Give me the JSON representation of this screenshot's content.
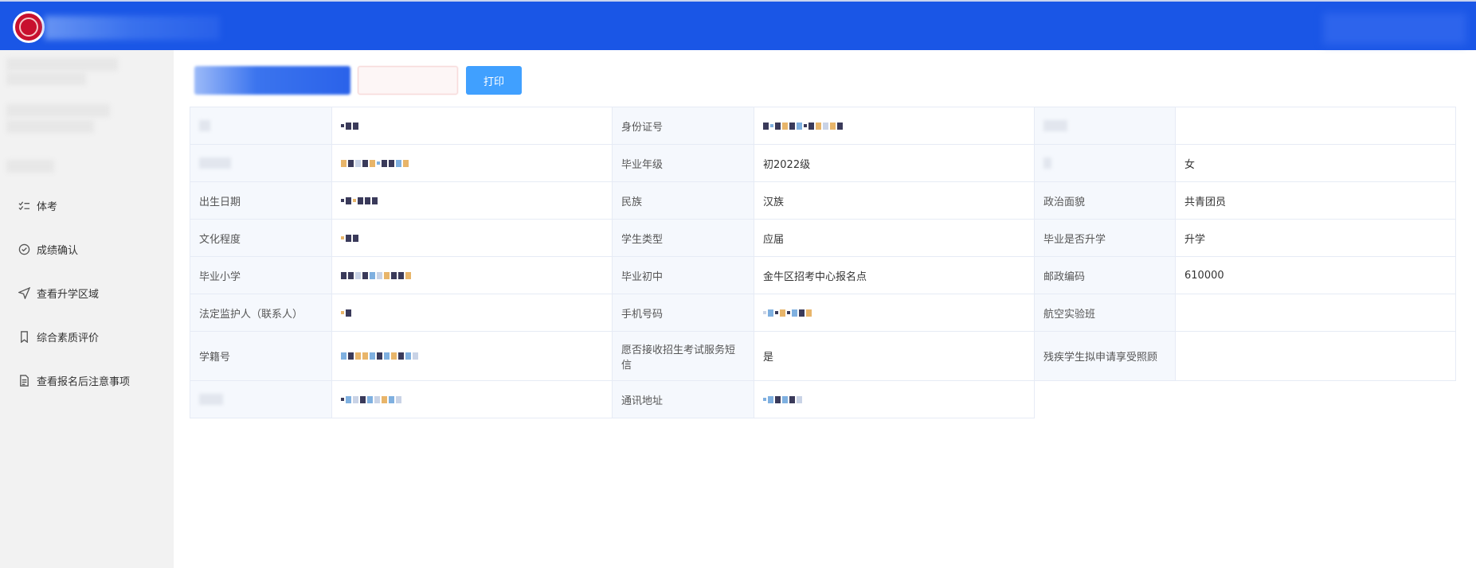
{
  "toolbar": {
    "print_label": "打印"
  },
  "sidebar": {
    "items": [
      {
        "label": "体考",
        "icon": "checklist-icon"
      },
      {
        "label": "成绩确认",
        "icon": "check-circle-icon"
      },
      {
        "label": "查看升学区域",
        "icon": "send-icon"
      },
      {
        "label": "综合素质评价",
        "icon": "bookmark-icon"
      },
      {
        "label": "查看报名后注意事项",
        "icon": "document-icon"
      }
    ]
  },
  "table": {
    "rows": [
      {
        "l1": "",
        "v1": "",
        "l2": "身份证号",
        "v2": "",
        "l3": "",
        "v3": ""
      },
      {
        "l1": "",
        "v1": "",
        "l2": "毕业年级",
        "v2": "初2022级",
        "l3": "",
        "v3": "女"
      },
      {
        "l1": "出生日期",
        "v1": "",
        "l2": "民族",
        "v2": "汉族",
        "l3": "政治面貌",
        "v3": "共青团员"
      },
      {
        "l1": "文化程度",
        "v1": "",
        "l2": "学生类型",
        "v2": "应届",
        "l3": "毕业是否升学",
        "v3": "升学"
      },
      {
        "l1": "毕业小学",
        "v1": "",
        "l2": "毕业初中",
        "v2": "金牛区招考中心报名点",
        "l3": "邮政编码",
        "v3": "610000"
      },
      {
        "l1": "法定监护人（联系人）",
        "v1": "",
        "l2": "手机号码",
        "v2": "",
        "l3": "航空实验班",
        "v3": ""
      },
      {
        "l1": "学籍号",
        "v1": "",
        "l2": "愿否接收招生考试服务短信",
        "v2": "是",
        "l3": "残疾学生拟申请享受照顾",
        "v3": ""
      },
      {
        "l1": "",
        "v1": "",
        "l2": "通讯地址",
        "v2": ""
      }
    ]
  },
  "colors": {
    "header": "#1a56e6",
    "primary_button": "#40a0ff",
    "sidebar_bg": "#f2f2f2",
    "label_bg": "#f5f8fd"
  }
}
